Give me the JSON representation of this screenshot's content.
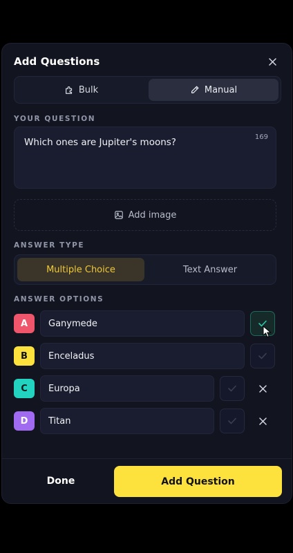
{
  "header": {
    "title": "Add Questions"
  },
  "mode_tabs": [
    {
      "label": "Bulk",
      "active": false
    },
    {
      "label": "Manual",
      "active": true
    }
  ],
  "question": {
    "section_label": "YOUR QUESTION",
    "value": "Which ones are Jupiter's moons?",
    "char_count": "169"
  },
  "add_image_label": "Add image",
  "answer_type": {
    "section_label": "ANSWER TYPE",
    "options": [
      {
        "label": "Multiple Choice",
        "selected": true
      },
      {
        "label": "Text Answer",
        "selected": false
      }
    ]
  },
  "answer_options": {
    "section_label": "ANSWER OPTIONS",
    "items": [
      {
        "letter": "A",
        "value": "Ganymede",
        "correct": true,
        "badge_color": "#f0566b",
        "letter_color": "#ffffff"
      },
      {
        "letter": "B",
        "value": "Enceladus",
        "correct": false,
        "badge_color": "#fde23e",
        "letter_color": "#111111"
      },
      {
        "letter": "C",
        "value": "Europa",
        "correct": false,
        "badge_color": "#22d3c0",
        "letter_color": "#0b1a1a"
      },
      {
        "letter": "D",
        "value": "Titan",
        "correct": false,
        "badge_color": "#a06bf0",
        "letter_color": "#ffffff"
      }
    ]
  },
  "footer": {
    "done_label": "Done",
    "add_question_label": "Add Question"
  },
  "colors": {
    "accent": "#fde23e",
    "correct_check": "#2ec4a6",
    "modal_bg": "#121420"
  }
}
